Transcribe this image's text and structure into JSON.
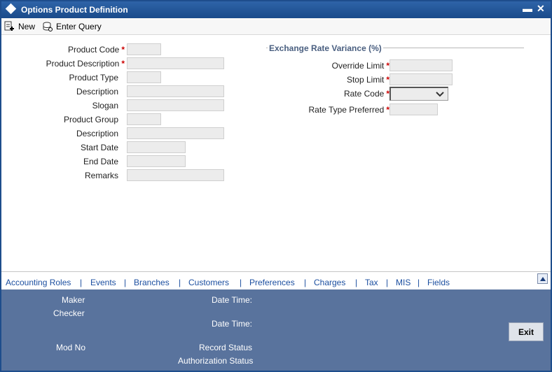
{
  "window": {
    "title": "Options Product Definition",
    "minimize_symbol": "▬",
    "close_symbol": "✕"
  },
  "toolbar": {
    "new_label": "New",
    "enter_query_label": "Enter Query"
  },
  "form": {
    "required_marker": "*",
    "product_code": {
      "label": "Product Code",
      "value": ""
    },
    "product_description": {
      "label": "Product Description",
      "value": ""
    },
    "product_type": {
      "label": "Product Type",
      "value": ""
    },
    "description": {
      "label": "Description",
      "value": ""
    },
    "slogan": {
      "label": "Slogan",
      "value": ""
    },
    "product_group": {
      "label": "Product Group",
      "value": ""
    },
    "group_description": {
      "label": "Description",
      "value": ""
    },
    "start_date": {
      "label": "Start Date",
      "value": ""
    },
    "end_date": {
      "label": "End Date",
      "value": ""
    },
    "remarks": {
      "label": "Remarks",
      "value": ""
    }
  },
  "exchange": {
    "section_title": "Exchange Rate Variance (%)",
    "override_limit": {
      "label": "Override Limit",
      "value": ""
    },
    "stop_limit": {
      "label": "Stop Limit",
      "value": ""
    },
    "rate_code": {
      "label": "Rate Code",
      "value": ""
    },
    "rate_type_preferred": {
      "label": "Rate Type Preferred",
      "value": ""
    }
  },
  "tabs": [
    "Accounting Roles",
    "Events",
    "Branches",
    "Customers",
    "Preferences",
    "Charges",
    "Tax",
    "MIS",
    "Fields"
  ],
  "tab_separator": "|",
  "footer": {
    "maker": "Maker",
    "checker": "Checker",
    "date_time_1": "Date Time:",
    "date_time_2": "Date Time:",
    "mod_no": "Mod No",
    "record_status": "Record Status",
    "authorization_status": "Authorization Status",
    "exit_label": "Exit"
  },
  "colors": {
    "titlebar": "#1a4a8a",
    "footer": "#59739d",
    "link": "#1c4fa0",
    "required": "#cc0000",
    "section": "#4a5f80"
  }
}
